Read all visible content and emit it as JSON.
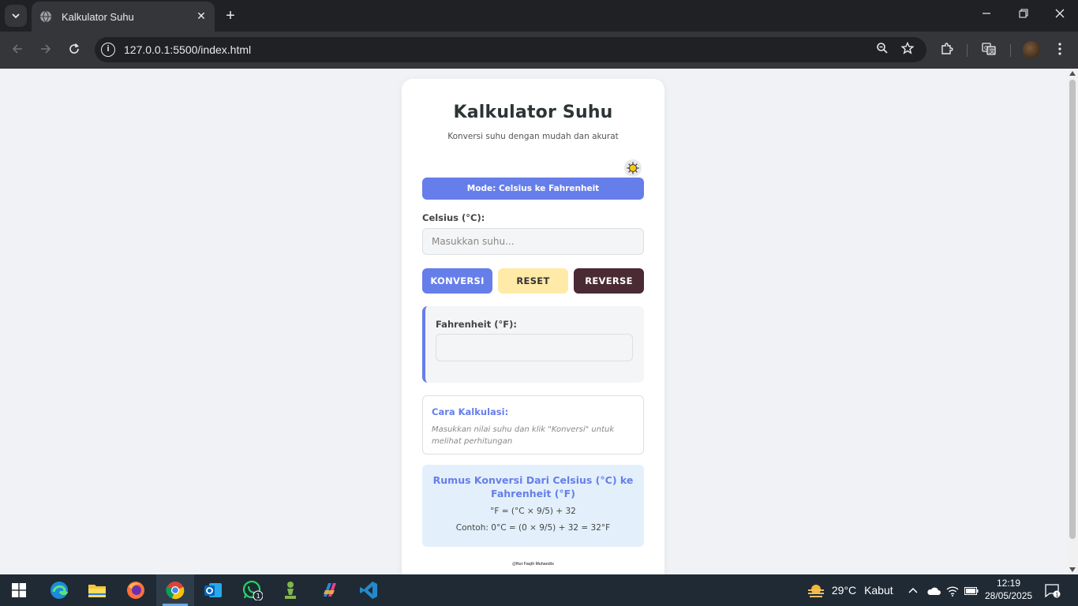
{
  "browser": {
    "tab_title": "Kalkulator Suhu",
    "tab_close": "✕",
    "new_tab": "+",
    "url": "127.0.0.1:5500/index.html",
    "icons": [
      "tab-menu-icon",
      "globe-icon",
      "back-icon",
      "forward-icon",
      "reload-icon",
      "site-info-icon",
      "zoom-icon",
      "star-icon",
      "extensions-icon",
      "translate-icon",
      "profile-avatar",
      "menu-icon"
    ]
  },
  "app": {
    "title": "Kalkulator Suhu",
    "subtitle": "Konversi suhu dengan mudah dan akurat",
    "theme_toggle_icon": "sun-icon",
    "mode_label": "Mode: Celsius ke Fahrenheit",
    "input_label": "Celsius (°C):",
    "input_placeholder": "Masukkan suhu...",
    "buttons": {
      "konversi": "KONVERSI",
      "reset": "RESET",
      "reverse": "REVERSE"
    },
    "result_label": "Fahrenheit (°F):",
    "result_value": "",
    "calc_title": "Cara Kalkulasi:",
    "calc_text": "Masukkan nilai suhu dan klik \"Konversi\" untuk melihat perhitungan",
    "formula_title": "Rumus Konversi Dari Celsius (°C) ke Fahrenheit (°F)",
    "formula": "°F = (°C × 9/5) + 32",
    "example": "Contoh: 0°C = (0 × 9/5) + 32 = 32°F",
    "footer": "@Nur Faqih Muhandis"
  },
  "colors": {
    "accent": "#667eea",
    "reset_bg": "#ffeaa7",
    "reverse_bg": "#4a2a33",
    "page_bg": "#f0f2f5"
  },
  "taskbar": {
    "apps": [
      "start-icon",
      "edge-icon",
      "file-explorer-icon",
      "firefox-icon",
      "chrome-icon",
      "outlook-icon",
      "whatsapp-icon",
      "chess-icon",
      "copilot-icon",
      "vscode-icon"
    ],
    "whatsapp_badge": "1",
    "weather_temp": "29°C",
    "weather_text": "Kabut",
    "time": "12:19",
    "date": "28/05/2025",
    "notification_count": "1"
  }
}
